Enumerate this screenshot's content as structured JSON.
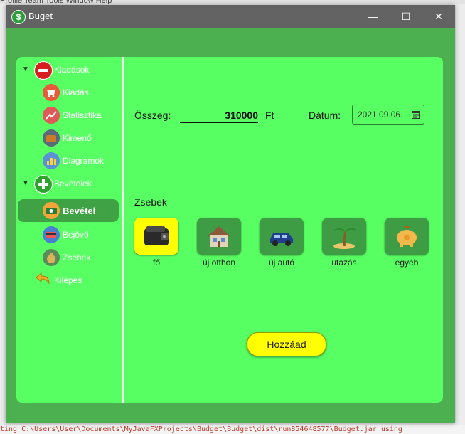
{
  "background": {
    "menu_fragment": "Profile   Team   Tools   Window   Help",
    "console_line": "ting C:\\Users\\User\\Documents\\MyJavaFXProjects\\Budget\\Budget\\dist\\run854648577\\Budget.jar using"
  },
  "window": {
    "title": "Buget",
    "minimize_glyph": "—",
    "maximize_glyph": "☐",
    "close_glyph": "✕"
  },
  "sidebar": {
    "items": [
      {
        "label": "Kiadások",
        "icon": "minus-circle-icon",
        "color": "#d81e1e",
        "level": 0,
        "expanded": true
      },
      {
        "label": "Kiadás",
        "icon": "cart-icon",
        "color": "#e85a3a",
        "level": 1
      },
      {
        "label": "Statisztika",
        "icon": "chart-line-icon",
        "color": "#e05858",
        "level": 1
      },
      {
        "label": "Kimenő",
        "icon": "wallet-out-icon",
        "color": "#5a6a7a",
        "level": 1
      },
      {
        "label": "Diagramok",
        "icon": "bar-chart-icon",
        "color": "#5b8fd6",
        "level": 1
      },
      {
        "label": "Bevételek",
        "icon": "plus-circle-icon",
        "color": "#2ea32e",
        "level": 0,
        "expanded": true
      },
      {
        "label": "Bevétel",
        "icon": "money-icon",
        "color": "#f3a63a",
        "level": 1,
        "selected": true
      },
      {
        "label": "Bejövő",
        "icon": "card-in-icon",
        "color": "#4a7fd0",
        "level": 1
      },
      {
        "label": "Zsebek",
        "icon": "money-bag-icon",
        "color": "#5b8a5b",
        "level": 1
      },
      {
        "label": "Kilépés",
        "icon": "exit-arrow-icon",
        "color": "#f0b020",
        "level": 0
      }
    ]
  },
  "form": {
    "amount_label": "Összeg:",
    "amount_value": "310000",
    "currency": "Ft",
    "date_label": "Dátum:",
    "date_value": "2021.09.06.",
    "calendar_icon": "calendar-icon",
    "pockets_label": "Zsebek",
    "pockets": [
      {
        "label": "fő",
        "icon": "wallet-icon",
        "selected": true
      },
      {
        "label": "új otthon",
        "icon": "house-icon",
        "selected": false
      },
      {
        "label": "új autó",
        "icon": "car-icon",
        "selected": false
      },
      {
        "label": "utazás",
        "icon": "palm-tree-icon",
        "selected": false
      },
      {
        "label": "egyéb",
        "icon": "piggy-bank-icon",
        "selected": false
      }
    ],
    "add_button": "Hozzáad"
  },
  "colors": {
    "panel": "#58ff63",
    "window_bg": "#4caf50",
    "selected_pocket": "#ffff00",
    "add_button": "#ffff00",
    "title_bar": "#636363"
  }
}
